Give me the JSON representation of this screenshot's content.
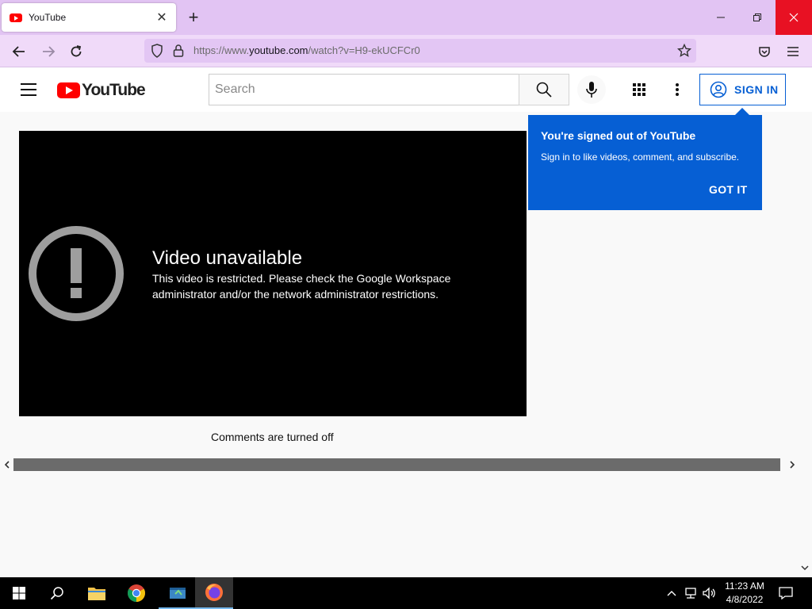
{
  "browser": {
    "tab_title": "YouTube",
    "url_prefix": "https://www.",
    "url_domain": "youtube.com",
    "url_path": "/watch?v=H9-ekUCFCr0",
    "window_controls": [
      "minimize",
      "restore",
      "close"
    ]
  },
  "header": {
    "logo_text": "YouTube",
    "search_placeholder": "Search",
    "signin_label": "SIGN IN"
  },
  "tooltip": {
    "title": "You're signed out of YouTube",
    "body": "Sign in to like videos, comment, and subscribe.",
    "button": "GOT IT"
  },
  "player": {
    "title": "Video unavailable",
    "reason": "This video is restricted. Please check the Google Workspace administrator and/or the network administrator restrictions."
  },
  "comments_status": "Comments are turned off",
  "taskbar": {
    "time": "11:23 AM",
    "date": "4/8/2022"
  },
  "colors": {
    "yt_red": "#ff0000",
    "yt_blue": "#065fd4",
    "browser_tab_bar": "#e2c4f3",
    "browser_nav_bar": "#f0daf9"
  }
}
